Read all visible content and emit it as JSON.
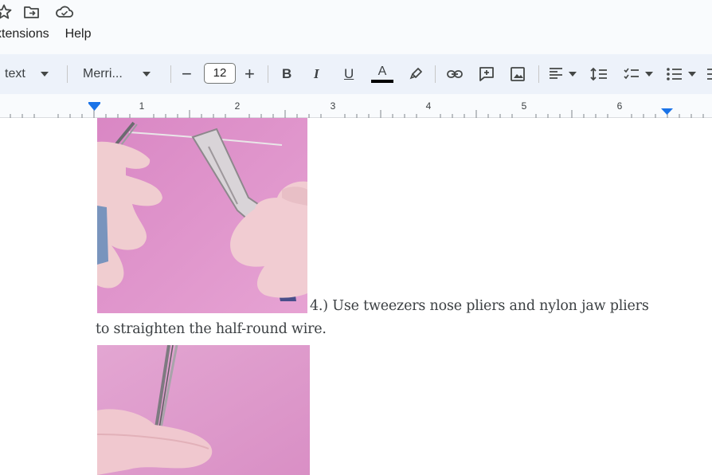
{
  "top_icons": [
    "star-icon",
    "move-to-folder-icon",
    "cloud-status-icon"
  ],
  "menu": {
    "items": [
      "xtensions",
      "Help"
    ]
  },
  "toolbar": {
    "style_label": "text",
    "font_label": "Merri...",
    "font_size": "12",
    "minus": "−",
    "plus": "+",
    "bold": "B",
    "italic": "I",
    "underline": "U",
    "text_color_letter": "A",
    "text_color": "#000000"
  },
  "ruler": {
    "numbers": [
      "1",
      "2",
      "3",
      "4",
      "5",
      "6"
    ],
    "marker_color": "#1a73e8"
  },
  "document": {
    "caption_line1": "4.) Use tweezers nose pliers and nylon jaw pliers",
    "caption_line2": "to straighten the half-round wire.",
    "photo_background": "#db93c7"
  }
}
